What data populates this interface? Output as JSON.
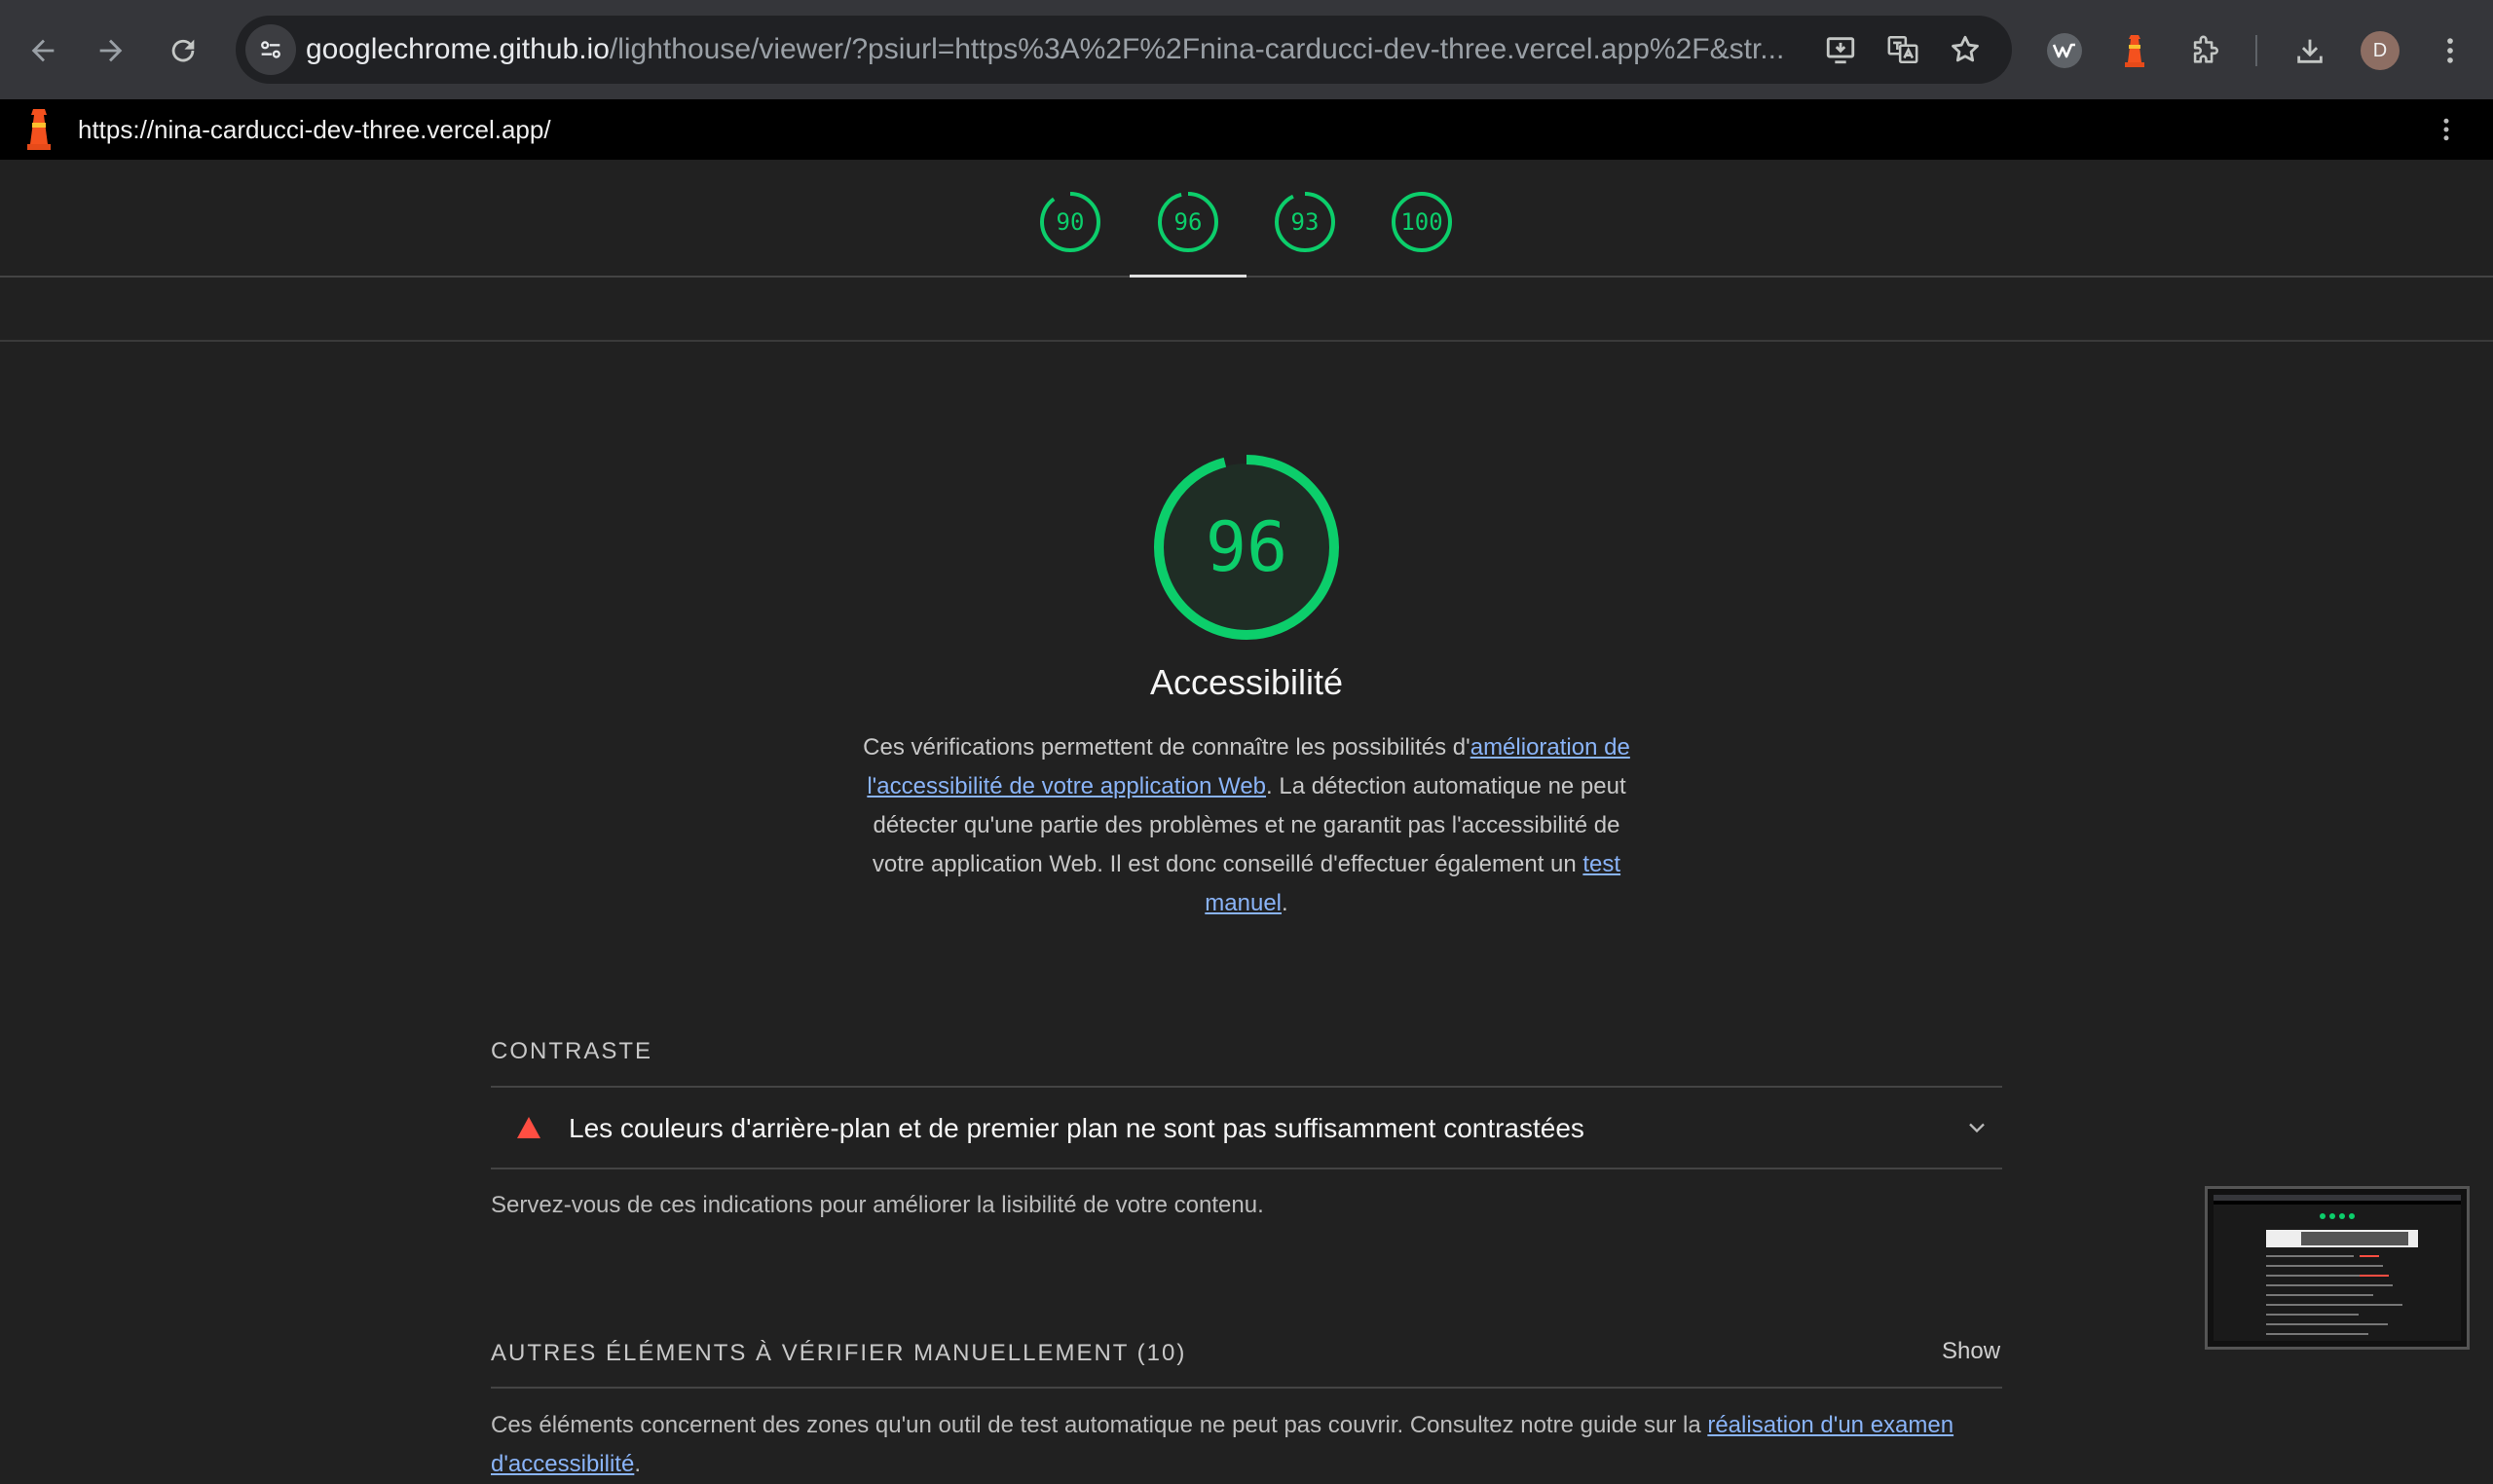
{
  "browser": {
    "url_host": "googlechrome.github.io",
    "url_path": "/lighthouse/viewer/?psiurl=https%3A%2F%2Fnina-carducci-dev-three.vercel.app%2F&str...",
    "avatar_letter": "D"
  },
  "lighthouse": {
    "report_url": "https://nina-carducci-dev-three.vercel.app/",
    "gauges": [
      {
        "score": "90",
        "value": 0.9
      },
      {
        "score": "96",
        "value": 0.96
      },
      {
        "score": "93",
        "value": 0.93
      },
      {
        "score": "100",
        "value": 1.0
      }
    ],
    "colors": {
      "pass": "#0cce6b",
      "fail": "#ff4e42"
    },
    "category": {
      "score": "96",
      "value": 0.96,
      "title": "Accessibilité",
      "desc_part1": "Ces vérifications permettent de connaître les possibilités d'",
      "desc_link1": "amélioration de l'accessibilité de votre application Web",
      "desc_part2": ". La détection automatique ne peut détecter qu'une partie des problèmes et ne garantit pas l'accessibilité de votre application Web. Il est donc conseillé d'effectuer également un ",
      "desc_link2": "test manuel",
      "desc_part3": "."
    },
    "contrast_group": {
      "title": "CONTRASTE",
      "audit_title": "Les couleurs d'arrière-plan et de premier plan ne sont pas suffisamment contrastées",
      "description": "Servez-vous de ces indications pour améliorer la lisibilité de votre contenu."
    },
    "manual_group": {
      "title": "AUTRES ÉLÉMENTS À VÉRIFIER MANUELLEMENT (10)",
      "show_label": "Show",
      "desc_part1": "Ces éléments concernent des zones qu'un outil de test automatique ne peut pas couvrir. Consultez notre guide sur la ",
      "desc_link": "réalisation d'un examen d'accessibilité",
      "desc_part2": "."
    }
  }
}
